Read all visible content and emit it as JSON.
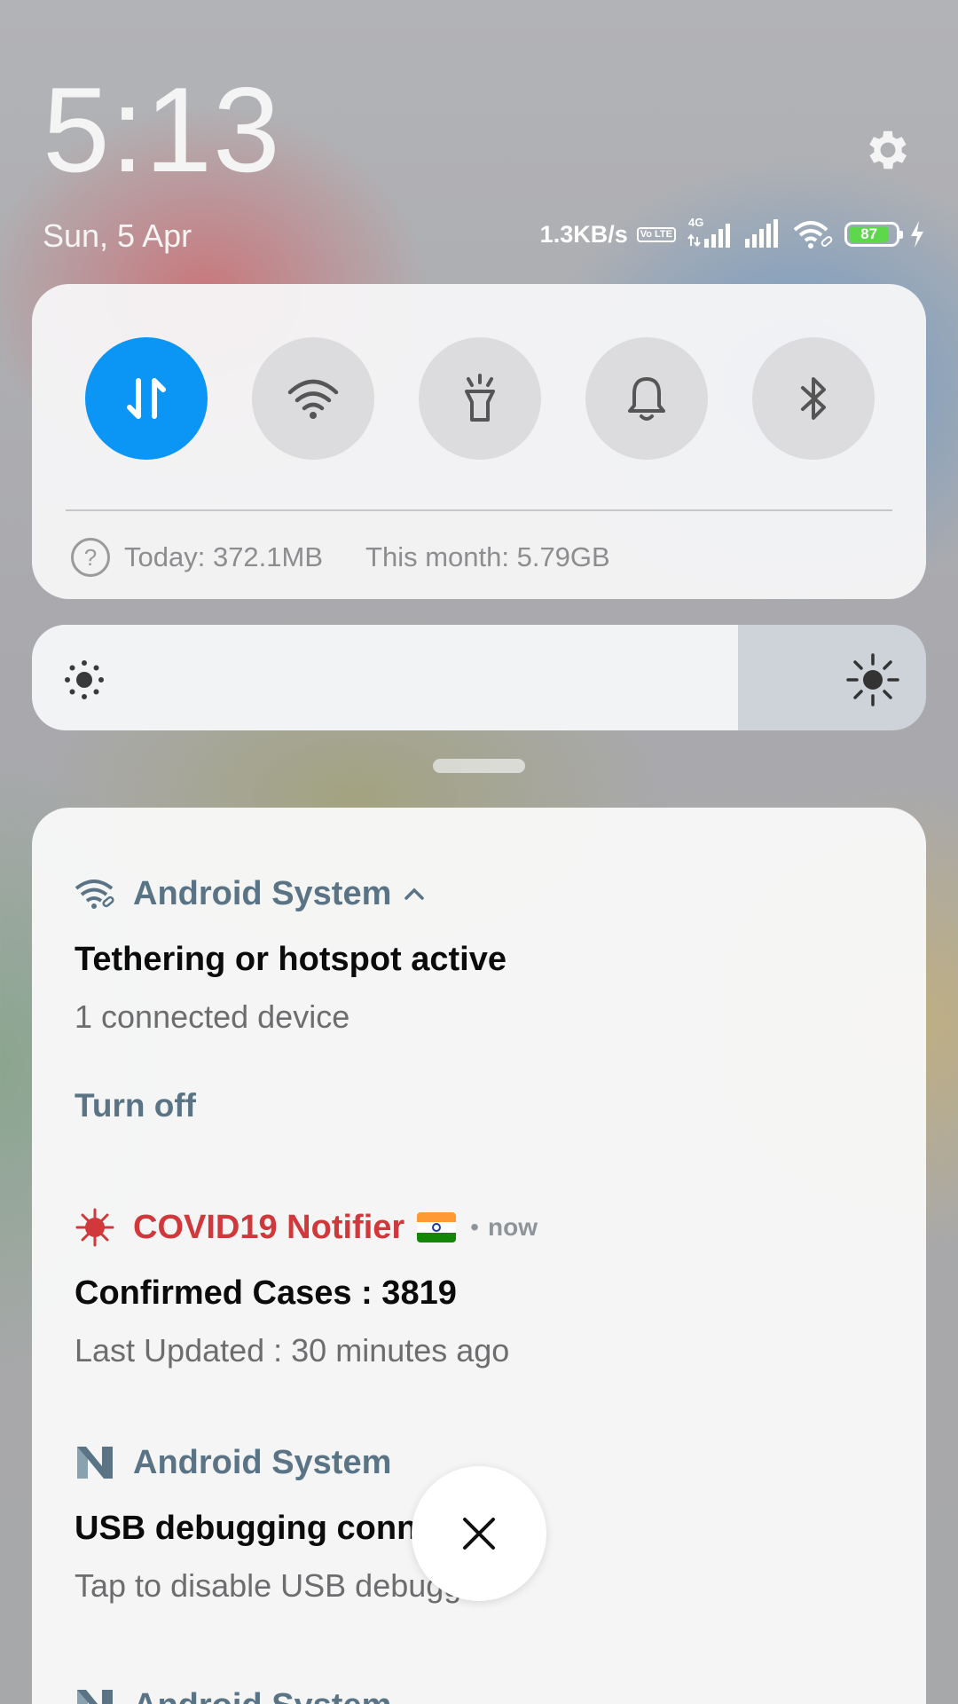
{
  "header": {
    "time": "5:13",
    "date": "Sun, 5 Apr"
  },
  "status_bar": {
    "network_speed": "1.3KB/s",
    "volte_label": "Vo LTE",
    "network_type": "4G",
    "battery_level": "87",
    "battery_percent": 87,
    "battery_color": "#5dd84a",
    "icons": [
      "volte-icon",
      "signal-4g-icon",
      "signal-icon",
      "wifi-link-icon",
      "battery-icon",
      "charging-icon"
    ]
  },
  "quick_settings": {
    "toggles": [
      {
        "name": "mobile-data",
        "icon": "data-arrows-icon",
        "active": true
      },
      {
        "name": "wifi",
        "icon": "wifi-icon",
        "active": false
      },
      {
        "name": "flashlight",
        "icon": "flashlight-icon",
        "active": false
      },
      {
        "name": "sound",
        "icon": "bell-icon",
        "active": false
      },
      {
        "name": "bluetooth",
        "icon": "bluetooth-icon",
        "active": false
      }
    ],
    "accent_color": "#0b96f5",
    "data_usage": {
      "today": "Today: 372.1MB",
      "month": "This month: 5.79GB"
    }
  },
  "brightness": {
    "level_percent": 79
  },
  "notifications": [
    {
      "app": "Android System",
      "icon": "wifi-hotspot-icon",
      "title": "Tethering or hotspot active",
      "text": "1 connected device",
      "action": "Turn off"
    },
    {
      "app": "COVID19 Notifier",
      "icon": "virus-icon",
      "time": "now",
      "title": "Confirmed Cases : 3819",
      "text": "Last Updated : 30 minutes ago",
      "accent_color": "#d0383b"
    },
    {
      "app": "Android System",
      "icon": "android-n-icon",
      "title": "USB debugging conne",
      "text": "Tap to disable USB debugg"
    },
    {
      "app": "Android System",
      "icon": "android-n-icon"
    }
  ],
  "dot_separator": "•"
}
